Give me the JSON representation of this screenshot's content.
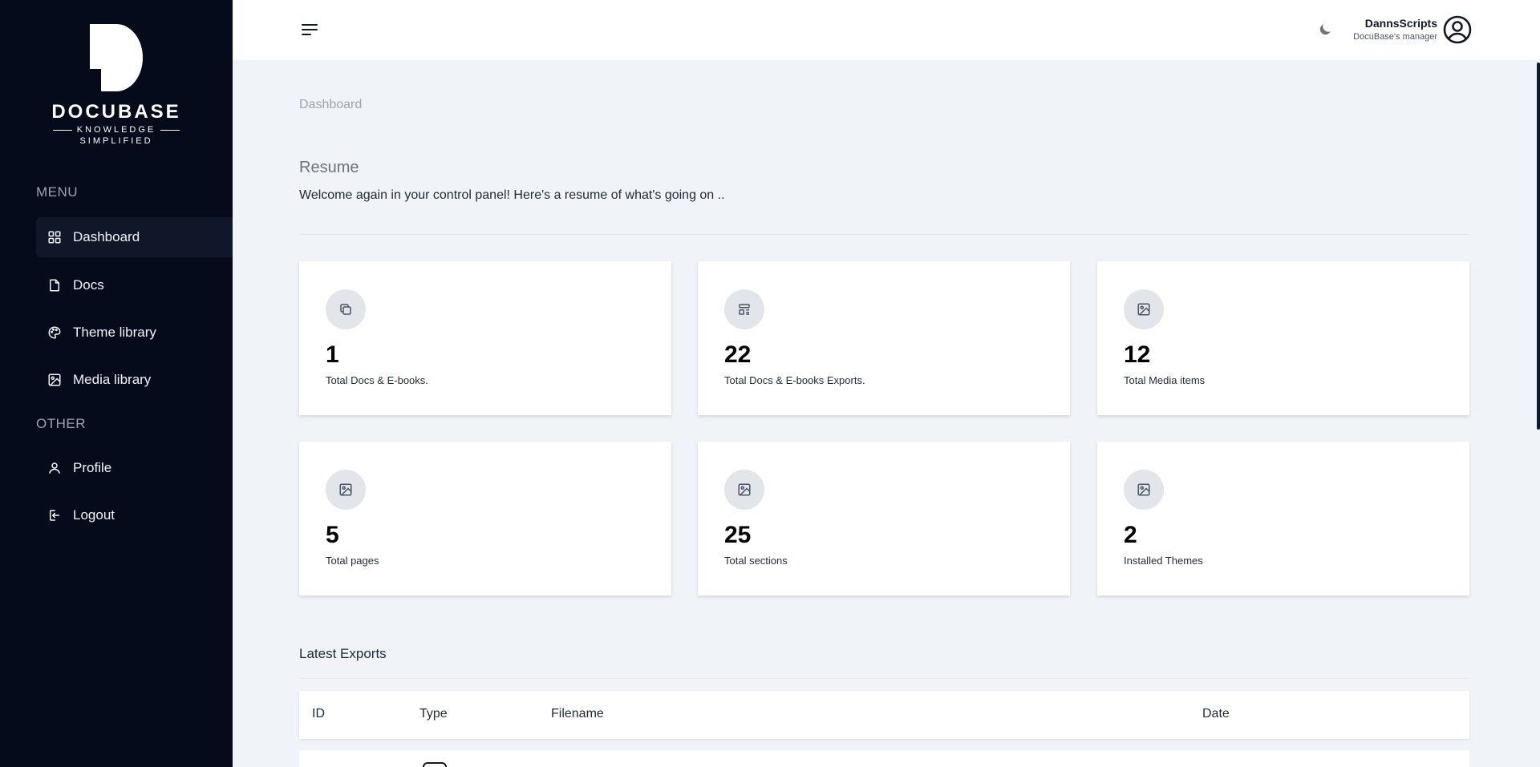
{
  "brand": {
    "name": "DOCUBASE",
    "tag_top": "KNOWLEDGE",
    "tag_bottom": "SIMPLIFIED"
  },
  "sidebar": {
    "menu_heading": "MENU",
    "other_heading": "OTHER",
    "items": [
      {
        "label": "Dashboard",
        "icon": "grid-icon"
      },
      {
        "label": "Docs",
        "icon": "file-icon"
      },
      {
        "label": "Theme library",
        "icon": "palette-icon"
      },
      {
        "label": "Media library",
        "icon": "image-icon"
      },
      {
        "label": "Profile",
        "icon": "user-icon"
      },
      {
        "label": "Logout",
        "icon": "logout-icon"
      }
    ]
  },
  "header": {
    "user_name": "DannsScripts",
    "user_role": "DocuBase's manager"
  },
  "page": {
    "breadcrumb": "Dashboard",
    "title": "Resume",
    "description": "Welcome again in your control panel! Here's a resume of what's going on .."
  },
  "stats": [
    {
      "value": "1",
      "label": "Total Docs & E-books.",
      "icon": "copy-icon"
    },
    {
      "value": "22",
      "label": "Total Docs & E-books Exports.",
      "icon": "layout-icon"
    },
    {
      "value": "12",
      "label": "Total Media items",
      "icon": "image-icon"
    },
    {
      "value": "5",
      "label": "Total pages",
      "icon": "image-icon"
    },
    {
      "value": "25",
      "label": "Total sections",
      "icon": "image-icon"
    },
    {
      "value": "2",
      "label": "Installed Themes",
      "icon": "image-icon"
    }
  ],
  "exports": {
    "title": "Latest Exports",
    "columns": [
      "ID",
      "Type",
      "Filename",
      "Date"
    ]
  }
}
